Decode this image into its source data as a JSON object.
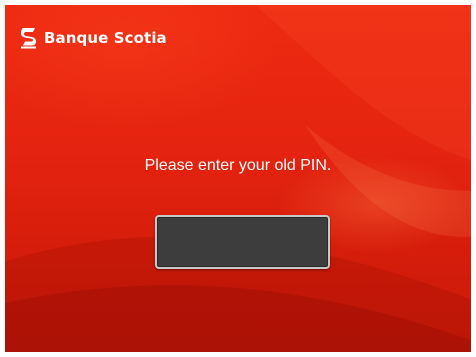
{
  "brand": {
    "logo_icon": "scotiabank-s-logo-icon",
    "name": "Banque Scotia"
  },
  "prompt": {
    "text": "Please enter your old PIN."
  },
  "pin_input": {
    "value": ""
  },
  "colors": {
    "background_red": "#e52410",
    "input_fill": "#3d3d3d",
    "input_border": "#c8c8c8",
    "text": "#ffffff"
  }
}
